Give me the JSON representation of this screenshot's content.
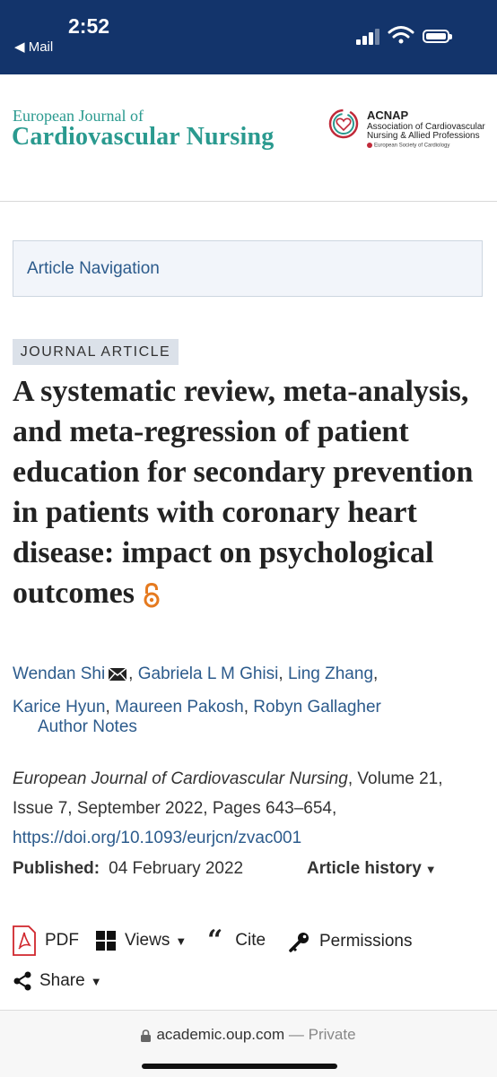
{
  "status_bar": {
    "time": "2:52",
    "back_label": "◀ Mail"
  },
  "header": {
    "journal_line1": "European Journal of",
    "journal_line2": "Cardiovascular Nursing",
    "acnap_title": "ACNAP",
    "acnap_subtitle": "Association of Cardiovascular Nursing & Allied Professions",
    "esc_label": "European Society of Cardiology"
  },
  "article_navigation": "Article Navigation",
  "article": {
    "type_badge": "JOURNAL ARTICLE",
    "title": "A systematic review, meta-analysis, and meta-regression of patient education for secondary prevention in patients with coronary heart disease: impact on psychological outcomes",
    "authors": [
      "Wendan Shi",
      "Gabriela L M Ghisi",
      "Ling Zhang",
      "Karice Hyun",
      "Maureen Pakosh",
      "Robyn Gallagher"
    ],
    "author_notes": "Author Notes",
    "journal_name": "European Journal of Cardiovascular Nursing",
    "citation_rest": ", Volume 21, Issue 7, September 2022, Pages 643–654,",
    "doi": "https://doi.org/10.1093/eurjcn/zvac001",
    "published_label": "Published:",
    "published_date": "04 February 2022",
    "article_history": "Article history"
  },
  "toolbar": {
    "pdf": "PDF",
    "views": "Views",
    "cite": "Cite",
    "permissions": "Permissions",
    "share": "Share"
  },
  "url_bar": {
    "domain": "academic.oup.com",
    "private": "— Private"
  },
  "colors": {
    "status_bar_bg": "#13346b",
    "journal_teal": "#2a9a8f",
    "link_blue": "#2c5b8c",
    "open_access_orange": "#e57a1f",
    "pdf_red": "#d0262c"
  },
  "icons": [
    "signal-icon",
    "wifi-icon",
    "battery-icon",
    "acnap-logo",
    "open-access-icon",
    "mail-icon",
    "pdf-icon",
    "views-grid-icon",
    "cite-quote-icon",
    "permissions-key-icon",
    "share-icon",
    "lock-icon"
  ]
}
